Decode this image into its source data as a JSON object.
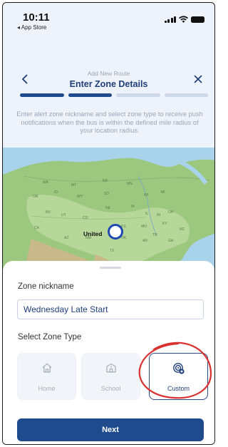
{
  "status_bar": {
    "time": "10:11",
    "back_app": "◂ App Store"
  },
  "header": {
    "subtitle": "Add New Route",
    "title": "Enter Zone Details",
    "back_icon": "chevron-left-icon",
    "close_icon": "close-icon"
  },
  "progress": {
    "steps": 4,
    "completed": 2
  },
  "intro_text": "Enter alert zone nickname and select zone type to receive push notifications when the bus is within the defined mile radius of your location radius.",
  "map": {
    "country_label": "United",
    "states": [
      "WA",
      "MT",
      "ND",
      "MN",
      "OR",
      "ID",
      "WY",
      "SD",
      "WI",
      "MI",
      "NV",
      "UT",
      "CO",
      "NE",
      "IA",
      "IL",
      "IN",
      "OH",
      "CA",
      "KS",
      "MO",
      "KY",
      "AZ",
      "NM",
      "OK",
      "TN",
      "NC",
      "TX",
      "AR",
      "GA"
    ]
  },
  "form": {
    "nickname_label": "Zone nickname",
    "nickname_value": "Wednesday Late Start",
    "zone_type_label": "Select Zone Type",
    "zone_types": [
      {
        "label": "Home",
        "icon": "home-icon",
        "selected": false
      },
      {
        "label": "School",
        "icon": "school-icon",
        "selected": false
      },
      {
        "label": "Custom",
        "icon": "custom-location-icon",
        "selected": true
      }
    ],
    "next_label": "Next"
  },
  "colors": {
    "primary": "#1f4b8e",
    "annotation": "#d93030"
  }
}
